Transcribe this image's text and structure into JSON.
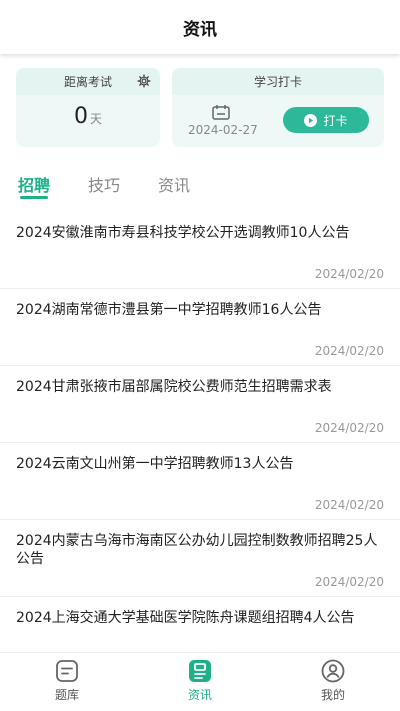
{
  "header": {
    "title": "资讯"
  },
  "exam_card": {
    "title": "距离考试",
    "count": "0",
    "unit": "天"
  },
  "checkin_card": {
    "title": "学习打卡",
    "date": "2024-02-27",
    "button_label": "打卡"
  },
  "tabs": [
    {
      "label": "招聘",
      "active": true
    },
    {
      "label": "技巧",
      "active": false
    },
    {
      "label": "资讯",
      "active": false
    }
  ],
  "news": [
    {
      "title": "2024安徽淮南市寿县科技学校公开选调教师10人公告",
      "date": "2024/02/20"
    },
    {
      "title": "2024湖南常德市澧县第一中学招聘教师16人公告",
      "date": "2024/02/20"
    },
    {
      "title": "2024甘肃张掖市届部属院校公费师范生招聘需求表",
      "date": "2024/02/20"
    },
    {
      "title": "2024云南文山州第一中学招聘教师13人公告",
      "date": "2024/02/20"
    },
    {
      "title": "2024内蒙古乌海市海南区公办幼儿园控制数教师招聘25人公告",
      "date": "2024/02/20"
    },
    {
      "title": "2024上海交通大学基础医学院陈舟课题组招聘4人公告",
      "date": ""
    }
  ],
  "tabbar": [
    {
      "label": "题库",
      "icon": "question-bank-icon",
      "active": false
    },
    {
      "label": "资讯",
      "icon": "news-icon",
      "active": true
    },
    {
      "label": "我的",
      "icon": "profile-icon",
      "active": false
    }
  ],
  "colors": {
    "accent": "#1fb08a",
    "button": "#2bb99a",
    "card_bg": "#eef8f6"
  }
}
